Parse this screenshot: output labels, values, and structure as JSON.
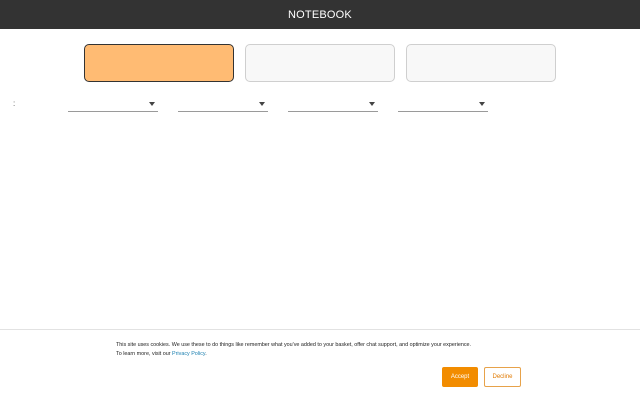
{
  "header": {
    "title": "NOTEBOOK"
  },
  "filters": {
    "label": ":"
  },
  "cookie": {
    "line1": "This site uses cookies. We use these to do things like remember what you've added to your basket, offer chat support, and optimize your experience.",
    "line2_prefix": "To learn more, visit our ",
    "link_text": "Privacy Policy",
    "line2_suffix": ".",
    "accept_label": "Accept",
    "decline_label": "Decline"
  },
  "colors": {
    "topbar": "#333333",
    "selected_card": "#ffbb73",
    "accent": "#f28c00",
    "link": "#1a7fb0"
  }
}
